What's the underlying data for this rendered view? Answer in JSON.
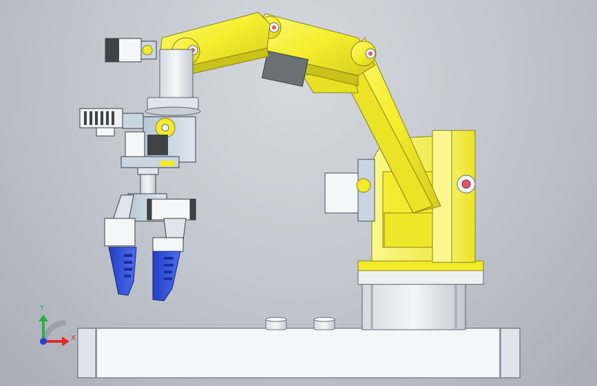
{
  "viewport": {
    "background_top": "#d6d9df",
    "background_bottom": "#a9adb6"
  },
  "model": {
    "parts": [
      "base-plate",
      "base-column",
      "shoulder-link",
      "upper-arm",
      "forearm",
      "wrist",
      "gripper",
      "gripper-fingers"
    ],
    "colors": {
      "arm": "#f5ee2e",
      "arm_shadow": "#c9c21a",
      "metal_light": "#e9edf1",
      "metal_blue": "#c9d6e2",
      "servo_dark": "#3f4246",
      "finger": "#2b4ed8",
      "finger_dark": "#1a2f9a",
      "pin": "#e05a6a"
    }
  },
  "triad": {
    "y_label": "Y",
    "x_label": "X",
    "y_color": "#21b34a",
    "x_color": "#e12a2a",
    "z_color": "#2a3fd8"
  }
}
